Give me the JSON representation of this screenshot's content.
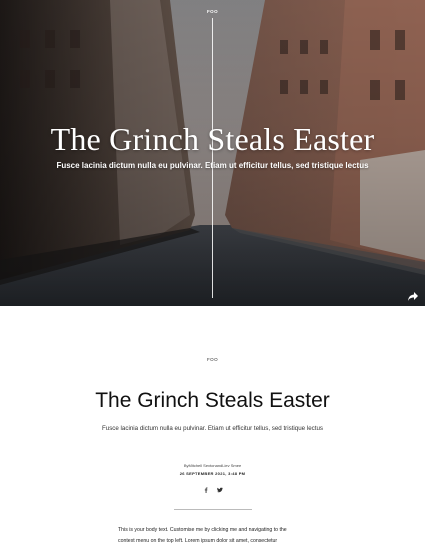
{
  "hero": {
    "tag": "FOO",
    "title": "The Grinch Steals Easter",
    "subtitle": "Fusce lacinia dictum nulla eu pulvinar. Etiam ut efficitur tellus, sed tristique lectus",
    "share_icon": "share-arrow-icon"
  },
  "article": {
    "tag": "FOO",
    "title": "The Grinch Steals Easter",
    "subtitle": "Fusce lacinia dictum nulla eu pulvinar. Etiam ut efficitur tellus, sed tristique lectus",
    "byline": "ByMitchell SextonandLiev Smee",
    "date": "26 SEPTEMBER 2021, 3:48 PM",
    "social": [
      "facebook-icon",
      "twitter-icon"
    ],
    "body_line1": "This is your body text. Customise me by clicking me and navigating to the",
    "body_line2": "context menu on the top left. Lorem ipsum dolor sit amet, consectetur"
  }
}
